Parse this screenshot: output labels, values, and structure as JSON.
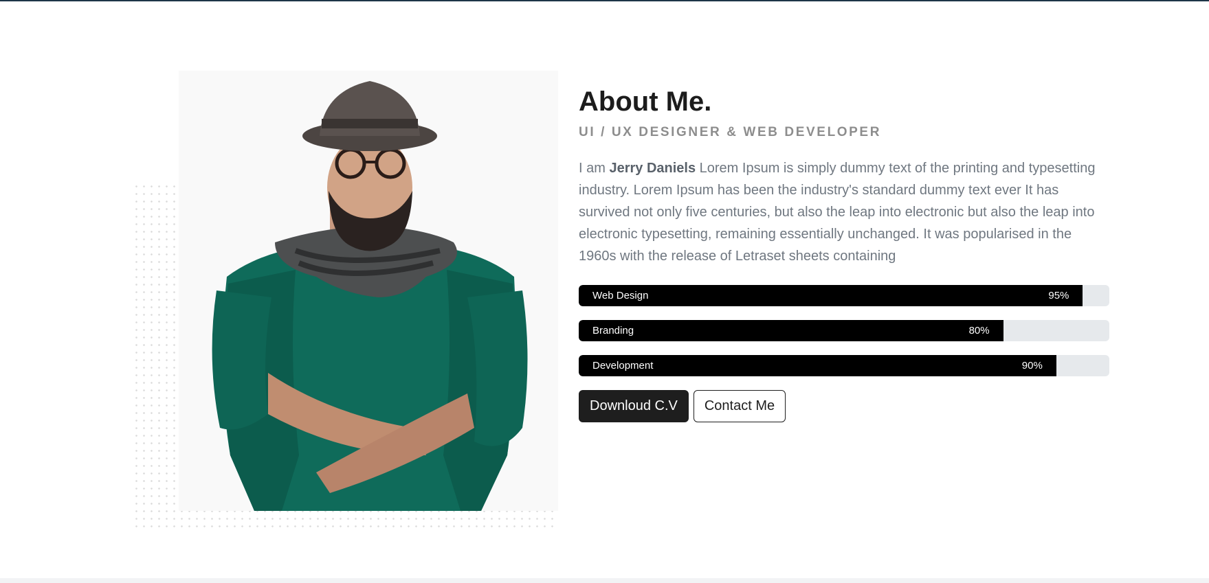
{
  "about": {
    "title": "About Me.",
    "subtitle": "UI / UX DESIGNER & WEB DEVELOPER",
    "intro_prefix": "I am ",
    "name": "Jerry Daniels",
    "intro_body": " Lorem Ipsum is simply dummy text of the printing and typesetting industry. Lorem Ipsum has been the industry's standard dummy text ever It has survived not only five centuries, but also the leap into electronic but also the leap into electronic typesetting, remaining essentially unchanged. It was popularised in the 1960s with the release of Letraset sheets containing"
  },
  "skills": [
    {
      "name": "Web Design",
      "percent_label": "95%",
      "value": 95
    },
    {
      "name": "Branding",
      "percent_label": "80%",
      "value": 80
    },
    {
      "name": "Development",
      "percent_label": "90%",
      "value": 90
    }
  ],
  "buttons": {
    "download_label": "Downloud C.V",
    "contact_label": "Contact Me"
  },
  "colors": {
    "bar_fill": "#000000",
    "bar_track": "#e6e9ec",
    "sweater": "#0f6b5a",
    "button_dark": "#1e1e1e"
  },
  "image": {
    "subject": "man in hat, glasses, scarf and green sweater with arms crossed"
  }
}
